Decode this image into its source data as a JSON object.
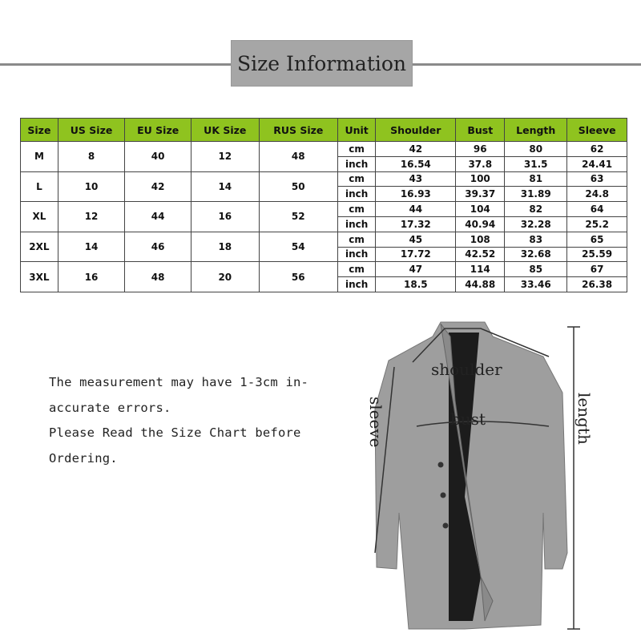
{
  "title": "Size Information",
  "table": {
    "headers": [
      "Size",
      "US Size",
      "EU Size",
      "UK Size",
      "RUS Size",
      "Unit",
      "Shoulder",
      "Bust",
      "Length",
      "Sleeve"
    ],
    "rows": [
      {
        "size": "M",
        "us": "8",
        "eu": "40",
        "uk": "12",
        "rus": "48",
        "cm": [
          "cm",
          "42",
          "96",
          "80",
          "62"
        ],
        "inch": [
          "inch",
          "16.54",
          "37.8",
          "31.5",
          "24.41"
        ]
      },
      {
        "size": "L",
        "us": "10",
        "eu": "42",
        "uk": "14",
        "rus": "50",
        "cm": [
          "cm",
          "43",
          "100",
          "81",
          "63"
        ],
        "inch": [
          "inch",
          "16.93",
          "39.37",
          "31.89",
          "24.8"
        ]
      },
      {
        "size": "XL",
        "us": "12",
        "eu": "44",
        "uk": "16",
        "rus": "52",
        "cm": [
          "cm",
          "44",
          "104",
          "82",
          "64"
        ],
        "inch": [
          "inch",
          "17.32",
          "40.94",
          "32.28",
          "25.2"
        ]
      },
      {
        "size": "2XL",
        "us": "14",
        "eu": "46",
        "uk": "18",
        "rus": "54",
        "cm": [
          "cm",
          "45",
          "108",
          "83",
          "65"
        ],
        "inch": [
          "inch",
          "17.72",
          "42.52",
          "32.68",
          "25.59"
        ]
      },
      {
        "size": "3XL",
        "us": "16",
        "eu": "48",
        "uk": "20",
        "rus": "56",
        "cm": [
          "cm",
          "47",
          "114",
          "85",
          "67"
        ],
        "inch": [
          "inch",
          "18.5",
          "44.88",
          "33.46",
          "26.38"
        ]
      }
    ],
    "header_color": "#8fc31f"
  },
  "note": [
    "The measurement may have 1-3cm in-",
    "accurate errors.",
    "Please Read the Size Chart before",
    "Ordering."
  ],
  "diagram": {
    "shoulder": "shoulder",
    "bust": "bust",
    "sleeve": "sleeve",
    "length": "length"
  }
}
